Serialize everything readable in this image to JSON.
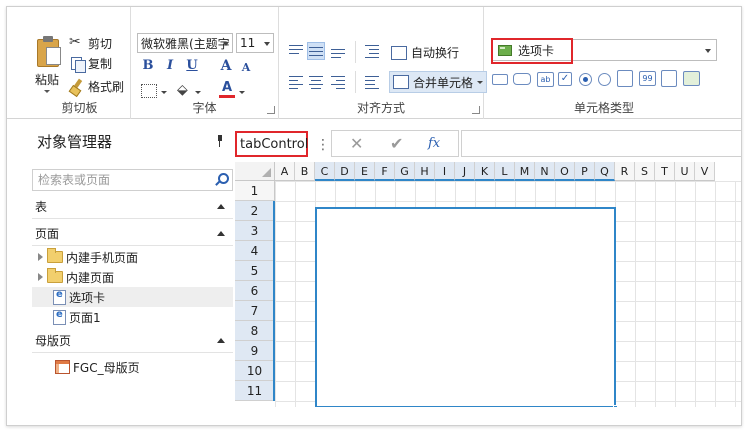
{
  "ribbon": {
    "clipboard": {
      "paste": "粘贴",
      "cut": "剪切",
      "copy": "复制",
      "format_painter": "格式刷",
      "group_label": "剪切板"
    },
    "font": {
      "font_name": "微软雅黑(主题字",
      "font_size": "11",
      "bold": "B",
      "italic": "I",
      "underline": "U",
      "grow": "A",
      "shrink": "A",
      "font_color": "A",
      "group_label": "字体"
    },
    "alignment": {
      "wrap_text": "自动换行",
      "merge_cells": "合并单元格",
      "group_label": "对齐方式"
    },
    "cell_type": {
      "selected": "选项卡",
      "group_label": "单元格类型"
    }
  },
  "object_manager": {
    "title": "对象管理器",
    "search_placeholder": "检索表或页面",
    "sections": {
      "tables": "表",
      "pages": "页面",
      "master_pages": "母版页"
    },
    "page_items": [
      {
        "label": "内建手机页面"
      },
      {
        "label": "内建页面"
      },
      {
        "label": "选项卡"
      },
      {
        "label": "页面1"
      }
    ],
    "master_items": [
      {
        "label": "FGC_母版页"
      }
    ]
  },
  "formula_bar": {
    "name_box": "tabControl",
    "separator": "⋮",
    "cancel": "✕",
    "confirm": "✔",
    "fx": "fx"
  },
  "grid": {
    "columns": [
      "A",
      "B",
      "C",
      "D",
      "E",
      "F",
      "G",
      "H",
      "I",
      "J",
      "K",
      "L",
      "M",
      "N",
      "O",
      "P",
      "Q",
      "R",
      "S",
      "T",
      "U",
      "V"
    ],
    "rows": [
      "1",
      "2",
      "3",
      "4",
      "5",
      "6",
      "7",
      "8",
      "9",
      "10",
      "11"
    ]
  },
  "colors": {
    "highlight_red": "#e0262b",
    "selection_blue": "#2f86c8"
  }
}
